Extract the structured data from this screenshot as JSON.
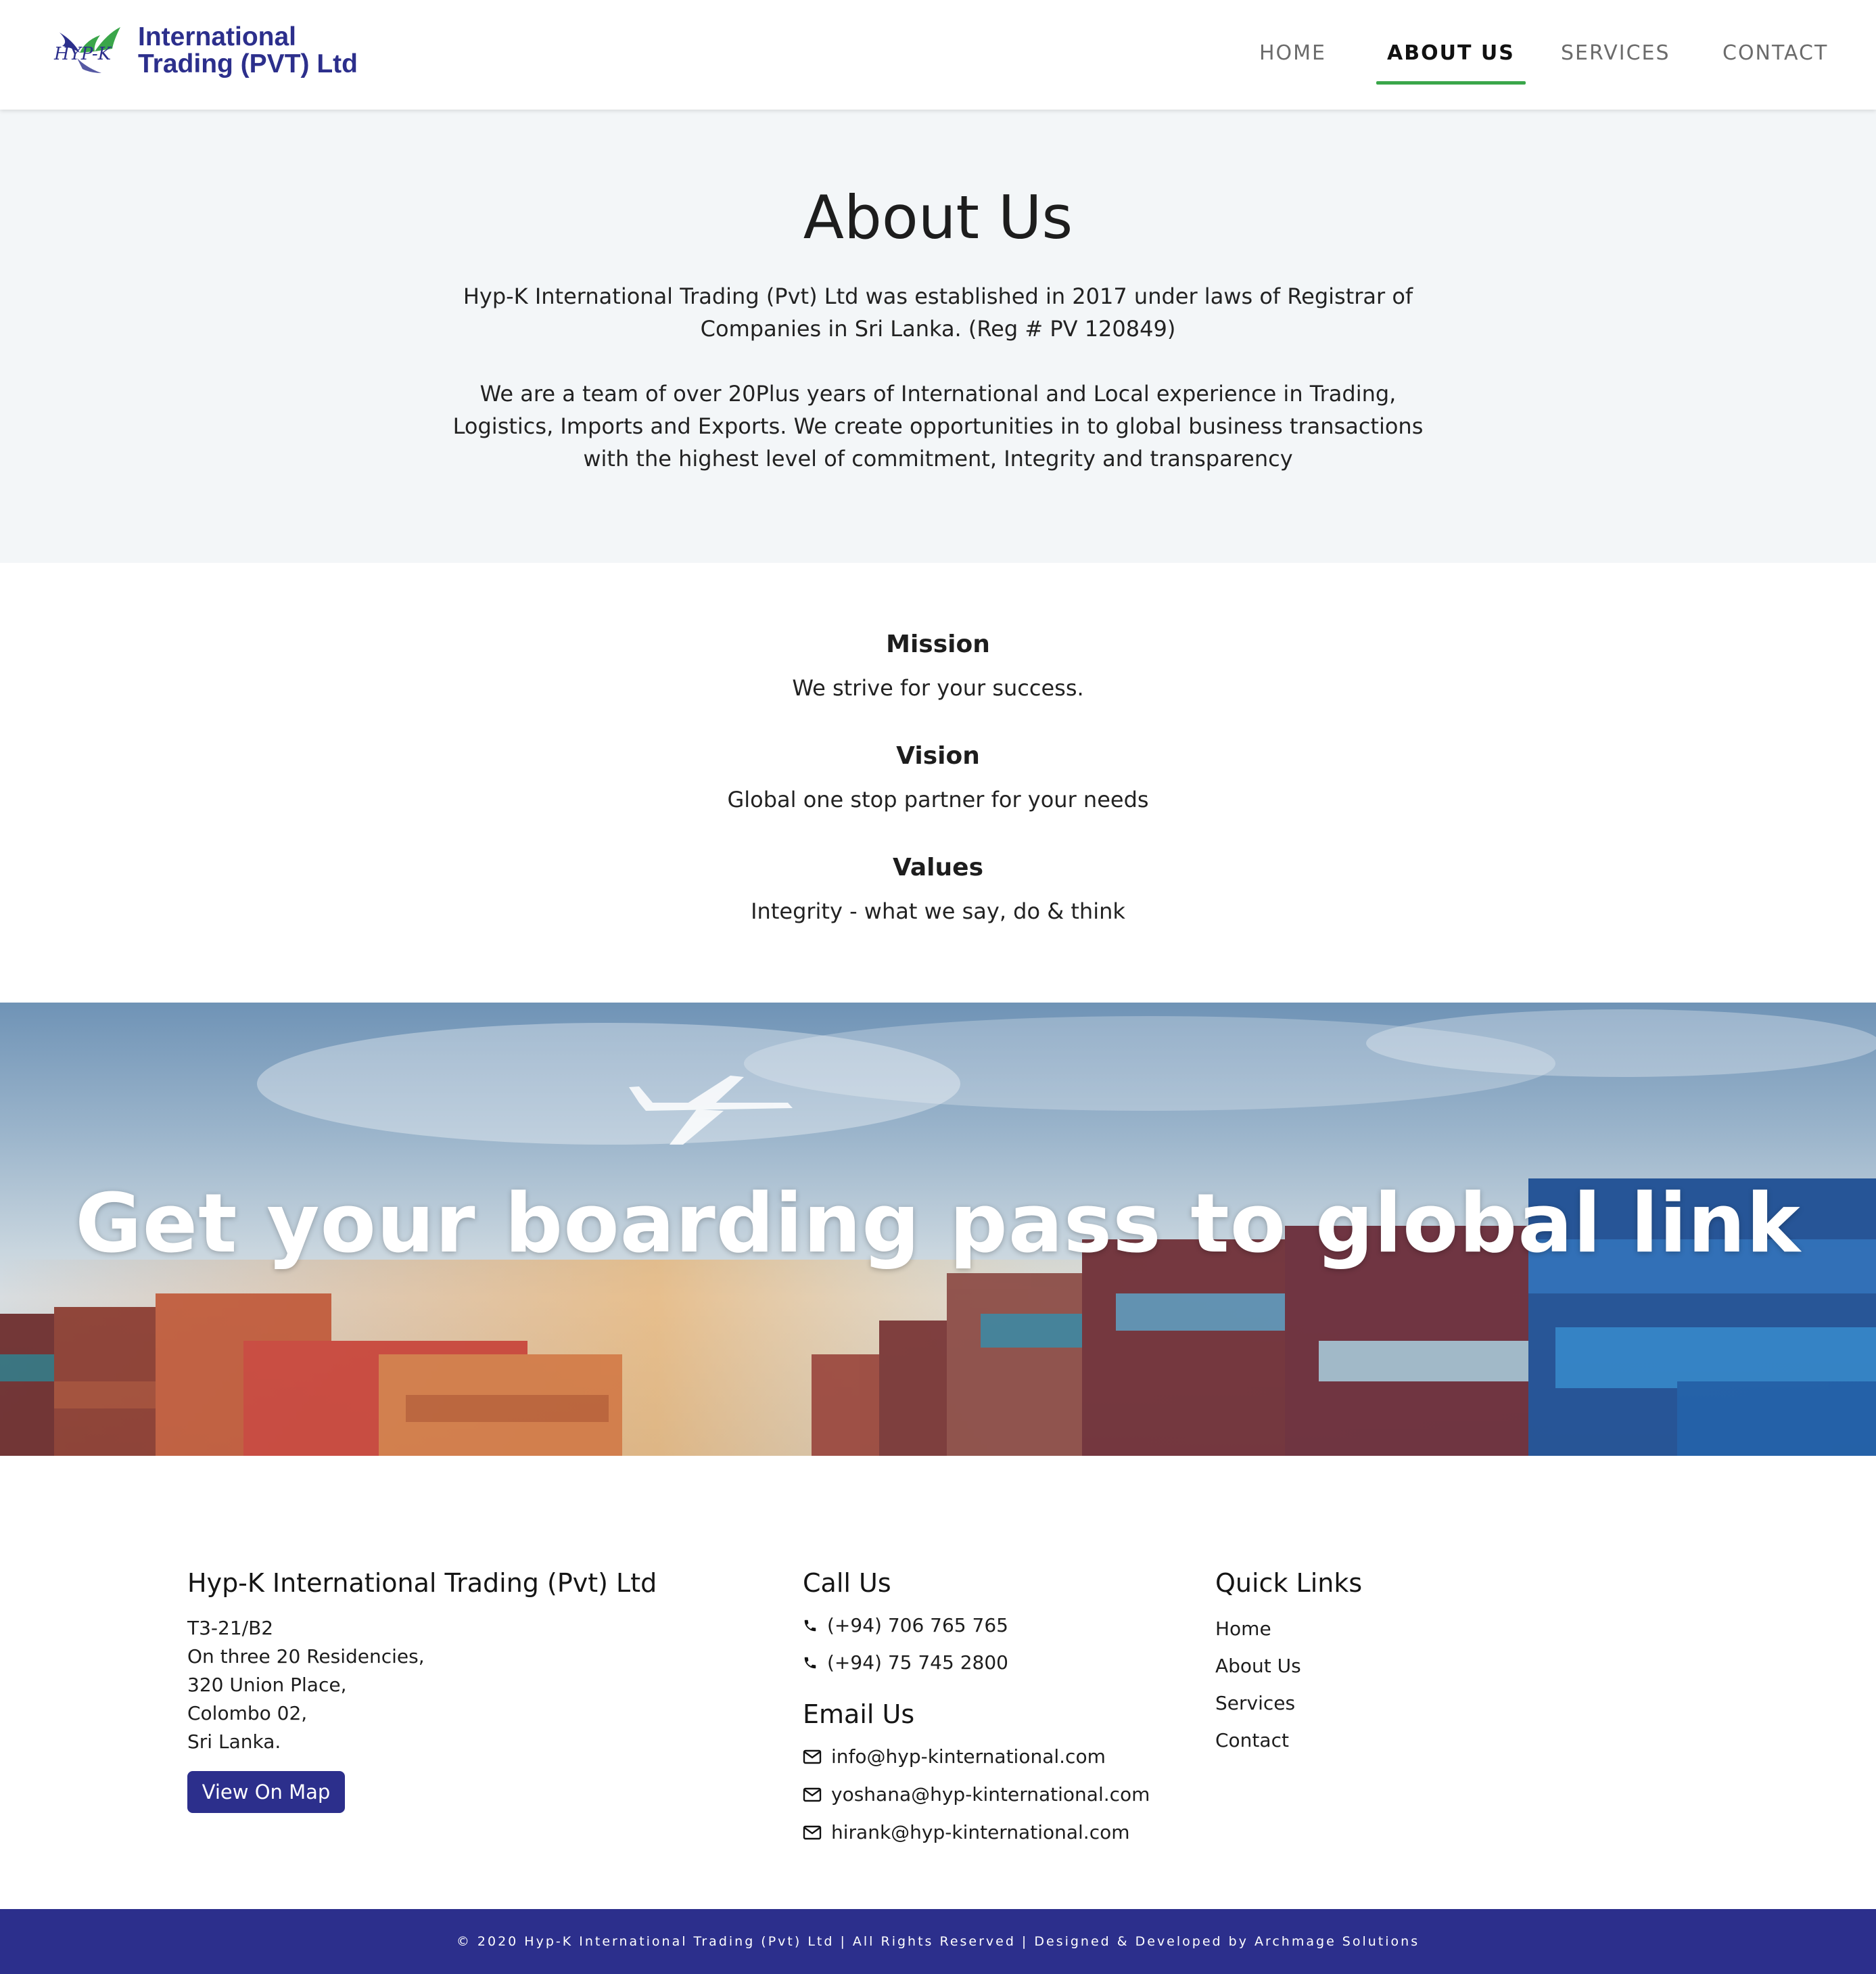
{
  "header": {
    "logo_monogram": "HYP-K",
    "logo_line1": "International",
    "logo_line2": "Trading (PVT) Ltd",
    "nav": [
      {
        "label": "HOME"
      },
      {
        "label": "ABOUT US",
        "active": true
      },
      {
        "label": "SERVICES"
      },
      {
        "label": "CONTACT"
      }
    ]
  },
  "about": {
    "title": "About Us",
    "paragraph1": "Hyp-K International Trading (Pvt) Ltd was established in 2017 under laws of Registrar of Companies in Sri Lanka. (Reg # PV 120849)",
    "paragraph2": "We are a team of over 20Plus years of International and Local experience in Trading, Logistics, Imports and Exports. We create opportunities in to global business transactions with the highest level of commitment, Integrity and transparency"
  },
  "mvv": {
    "mission_title": "Mission",
    "mission_text": "We strive for your success.",
    "vision_title": "Vision",
    "vision_text": "Global one stop partner for your needs",
    "values_title": "Values",
    "values_text": "Integrity - what we say, do & think"
  },
  "banner": {
    "title": "Get your boarding pass to global link"
  },
  "footer": {
    "company_title": "Hyp-K International Trading (Pvt) Ltd",
    "address": [
      "T3-21/B2",
      "On three 20 Residencies,",
      "320 Union Place,",
      "Colombo 02,",
      "Sri Lanka."
    ],
    "map_button": "View On Map",
    "call_title": "Call Us",
    "phones": [
      "(+94) 706 765 765",
      "(+94) 75 745 2800"
    ],
    "email_title": "Email Us",
    "emails": [
      "info@hyp-kinternational.com",
      "yoshana@hyp-kinternational.com",
      "hirank@hyp-kinternational.com"
    ],
    "quick_links_title": "Quick Links",
    "quick_links": [
      "Home",
      "About Us",
      "Services",
      "Contact"
    ]
  },
  "copyright": "© 2020 Hyp-K International Trading (Pvt) Ltd | All Rights Reserved | Designed & Developed by Archmage Solutions",
  "colors": {
    "brand_blue": "#2c2f8c",
    "accent_green": "#3aa64a",
    "about_bg": "#f3f6f8"
  },
  "icons": {
    "phone": "phone-icon",
    "email": "envelope-icon"
  }
}
